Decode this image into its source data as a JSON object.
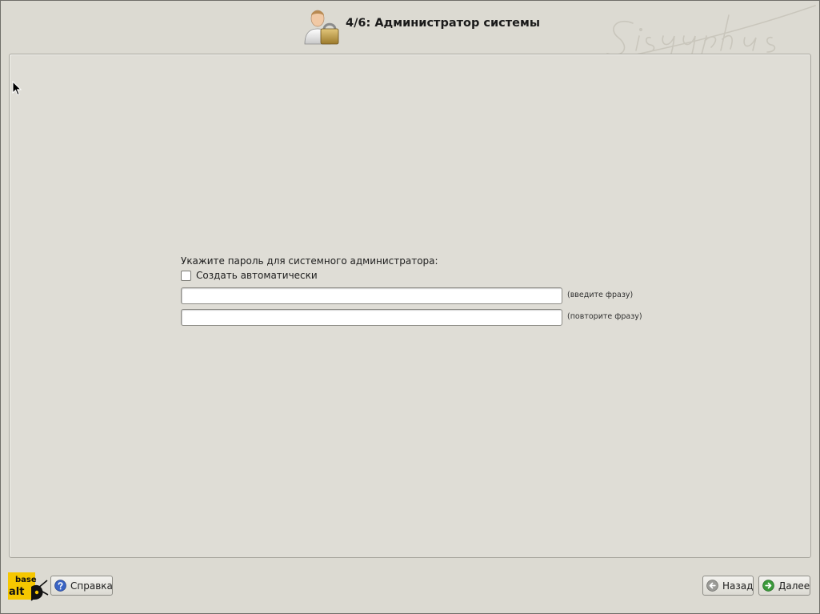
{
  "header": {
    "title": "4/6: Администратор системы",
    "icon": "user-lock-icon",
    "watermark": "Sisyphus"
  },
  "form": {
    "prompt": "Укажите пароль для системного администратора:",
    "auto_checkbox": {
      "label": "Создать автоматически",
      "checked": false
    },
    "password": {
      "value": "",
      "hint": "(введите фразу)"
    },
    "password_confirm": {
      "value": "",
      "hint": "(повторите фразу)"
    }
  },
  "footer": {
    "logo_top": "base",
    "logo_bottom": "alt",
    "help_label": "Справка",
    "back_label": "Назад",
    "next_label": "Далее"
  },
  "colors": {
    "background": "#dcdad2",
    "accent_green": "#3b9a3b",
    "help_blue": "#3a64c4",
    "logo_yellow": "#f6c700"
  }
}
